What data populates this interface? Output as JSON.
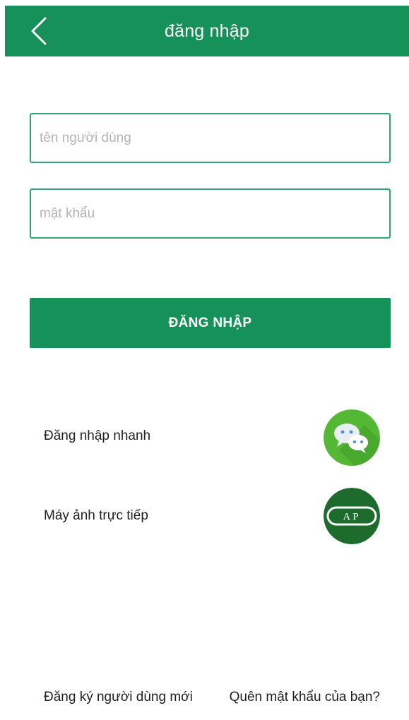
{
  "header": {
    "title": "đăng nhập",
    "back_icon": "chevron-left-icon",
    "background": "#17915a"
  },
  "form": {
    "username_placeholder": "tên người dùng",
    "username_value": "",
    "password_placeholder": "mật khẩu",
    "password_value": "",
    "field_border_color": "#33a374"
  },
  "login_button": {
    "label": "ĐĂNG NHẬP",
    "color": "#17915a"
  },
  "options": {
    "quick_login": {
      "label": "Đăng nhập nhanh",
      "icon": "wechat-icon",
      "color": "#54b834"
    },
    "live_camera": {
      "label": "Máy ảnh trực tiếp",
      "icon": "ap-camera-icon",
      "icon_text": "AP",
      "color": "#1e6b2e"
    }
  },
  "footer": {
    "register_label": "Đăng ký người dùng mới",
    "forgot_label": "Quên mật khẩu của bạn?"
  }
}
